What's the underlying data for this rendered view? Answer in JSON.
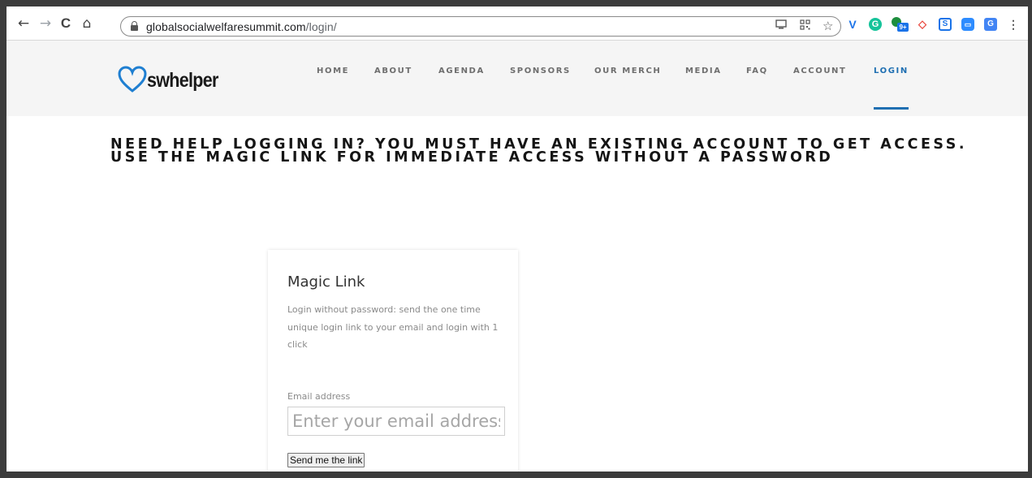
{
  "browser": {
    "url_host": "globalsocialwelfaresummit.com",
    "url_path": "/login/",
    "back_icon": "←",
    "forward_icon": "→",
    "reload_icon": "C",
    "home_icon": "⌂",
    "star_icon": "☆",
    "extensions": [
      {
        "name": "vimeo-icon",
        "glyph": "V",
        "color": "#1a73e8"
      },
      {
        "name": "grammarly-icon",
        "glyph": "G",
        "color": "#15c39a"
      },
      {
        "name": "extension-badge-icon",
        "glyph": "9+",
        "color": "#1e8e3e"
      },
      {
        "name": "arrow-extension-icon",
        "glyph": "◇",
        "color": "#e8453c"
      },
      {
        "name": "screen-extension-icon",
        "glyph": "S",
        "color": "#1a73e8"
      },
      {
        "name": "zoom-icon",
        "glyph": "▭",
        "color": "#2d8cff"
      },
      {
        "name": "translate-icon",
        "glyph": "G",
        "color": "#4285f4"
      }
    ]
  },
  "site": {
    "logo_text": "swhelper",
    "brand_color": "#1f6fb2",
    "nav": [
      "HOME",
      "ABOUT",
      "AGENDA",
      "SPONSORS",
      "OUR MERCH",
      "MEDIA",
      "FAQ",
      "ACCOUNT",
      "LOGIN"
    ],
    "active_nav": "LOGIN"
  },
  "page": {
    "headline_line1": "NEED HELP LOGGING IN? YOU MUST HAVE AN EXISTING ACCOUNT TO GET ACCESS.",
    "headline_line2": "USE THE MAGIC LINK FOR IMMEDIATE ACCESS WITHOUT A PASSWORD",
    "card": {
      "title": "Magic Link",
      "description": "Login without password: send the one time unique login link to your email and login with 1 click",
      "email_label": "Email address",
      "email_placeholder": "Enter your email address",
      "email_value": "",
      "button_label": "Send me the link"
    }
  }
}
